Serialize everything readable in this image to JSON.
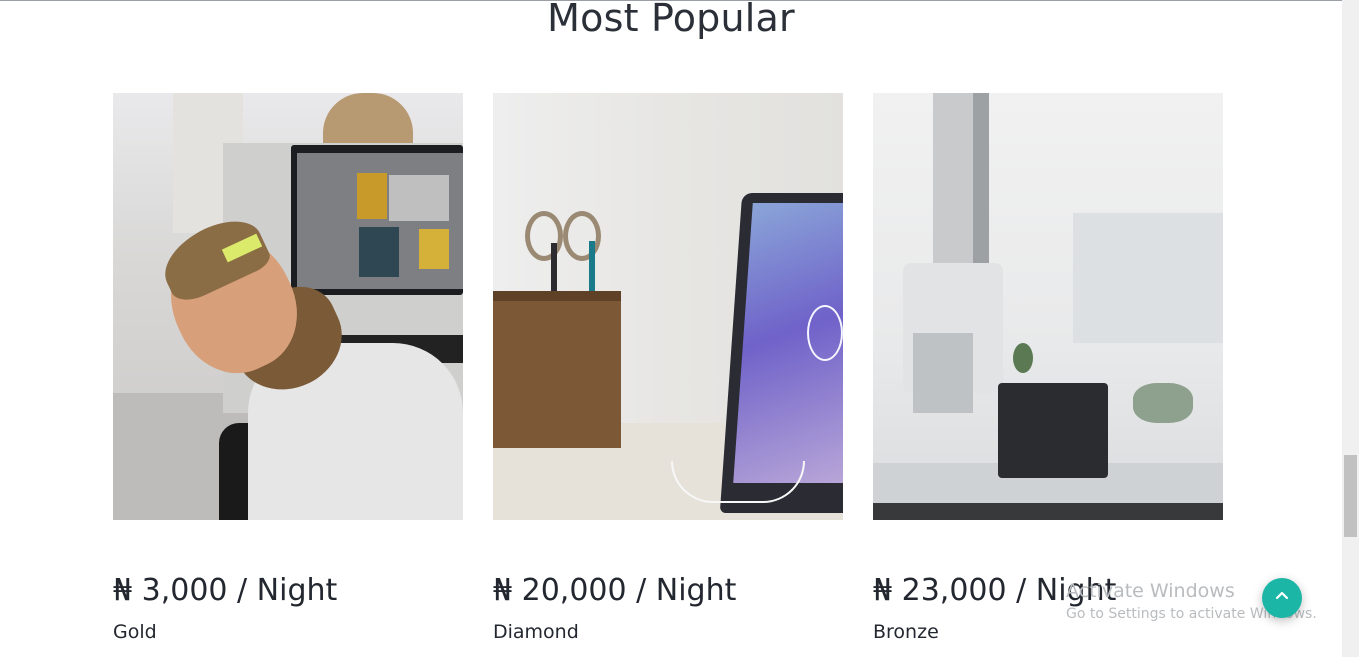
{
  "section": {
    "title": "Most Popular"
  },
  "cards": [
    {
      "price": "₦ 3,000 / Night",
      "tier": "Gold",
      "image": "office-worker-smiling-photo"
    },
    {
      "price": "₦ 20,000 / Night",
      "tier": "Diamond",
      "image": "desk-pencil-holder-laptop-photo"
    },
    {
      "price": "₦ 23,000 / Night",
      "tier": "Bronze",
      "image": "blurred-office-photo"
    }
  ],
  "watermark": {
    "title": "Activate Windows",
    "subtitle": "Go to Settings to activate Windows."
  },
  "back_to_top": {
    "icon": "chevron-up-icon",
    "color": "#1bb6a5"
  }
}
